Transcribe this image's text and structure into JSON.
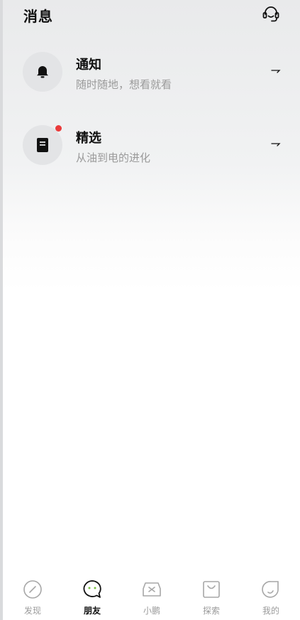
{
  "header": {
    "title": "消息",
    "support_icon": "headset-icon"
  },
  "messages": [
    {
      "title": "通知",
      "subtitle": "随时随地，想看就看",
      "icon": "bell-icon",
      "unread": false
    },
    {
      "title": "精选",
      "subtitle": "从油到电的进化",
      "icon": "document-icon",
      "unread": true
    }
  ],
  "colors": {
    "unread_dot": "#ea3b3b",
    "accent": "#111111",
    "muted": "#9a9a9a"
  },
  "tabbar": {
    "active": "朋友",
    "items": [
      {
        "label": "发现",
        "icon": "compass-icon"
      },
      {
        "label": "朋友",
        "icon": "chat-bubble-icon"
      },
      {
        "label": "小鹏",
        "icon": "car-icon"
      },
      {
        "label": "探索",
        "icon": "shopping-bag-icon"
      },
      {
        "label": "我的",
        "icon": "profile-icon"
      }
    ]
  }
}
